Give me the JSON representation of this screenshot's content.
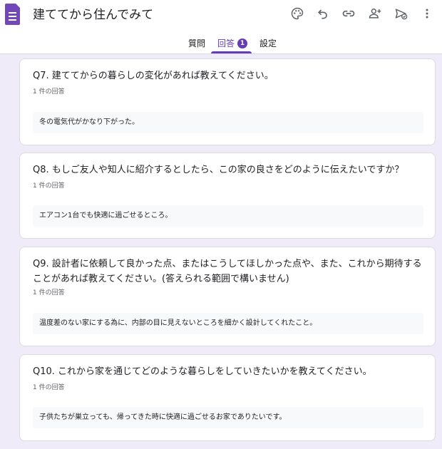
{
  "app": {
    "title": "建ててから住んでみて",
    "icons": [
      "forms-logo-icon",
      "palette-icon",
      "undo-icon",
      "link-icon",
      "add-collaborator-icon",
      "send-icon",
      "more-vert-icon"
    ]
  },
  "tabs": [
    {
      "label": "質問"
    },
    {
      "label": "回答",
      "badge": "1"
    },
    {
      "label": "設定"
    }
  ],
  "accent_color": "#673ab7",
  "questions": [
    {
      "title": "Q7. 建ててからの暮らしの変化があれば教えてください。",
      "count": "1 件の回答",
      "answer": "冬の電気代がかなり下がった。"
    },
    {
      "title": "Q8. もしご友人や知人に紹介するとしたら、この家の良さをどのように伝えたいですか？",
      "count": "1 件の回答",
      "answer": "エアコン1台でも快適に過ごせるところ。"
    },
    {
      "title": "Q9. 設計者に依頼して良かった点、またはこうしてほしかった点や、また、これから期待することがあれば教えてください。(答えられる範囲で構いません)",
      "count": "1 件の回答",
      "answer": "温度差のない家にする為に、内部の目に見えないところを細かく設計してくれたこと。"
    },
    {
      "title": "Q10. これから家を通じてどのような暮らしをしていきたいかを教えてください。",
      "count": "1 件の回答",
      "answer": "子供たちが巣立っても、帰ってきた時に快適に過ごせるお家でありたいです。"
    }
  ]
}
